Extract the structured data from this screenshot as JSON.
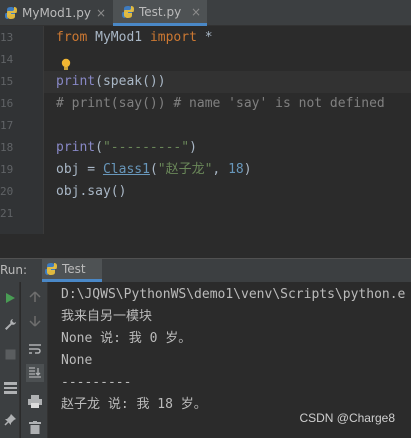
{
  "tabs": [
    {
      "label": "MyMod1.py",
      "close": "×"
    },
    {
      "label": "Test.py",
      "close": "×"
    }
  ],
  "editor": {
    "line_numbers": [
      "13",
      "14",
      "15",
      "16",
      "17",
      "18",
      "19",
      "20",
      "21"
    ],
    "lines": [
      [
        {
          "t": "from",
          "c": "kw"
        },
        {
          "t": " MyMod1 ",
          "c": "plain"
        },
        {
          "t": "import",
          "c": "kw"
        },
        {
          "t": " *",
          "c": "plain"
        }
      ],
      [],
      [
        {
          "t": "print",
          "c": "fn"
        },
        {
          "t": "(speak())",
          "c": "plain"
        }
      ],
      [
        {
          "t": "# print(say()) # name 'say' is not defined",
          "c": "cmt"
        }
      ],
      [],
      [
        {
          "t": "print",
          "c": "fn"
        },
        {
          "t": "(",
          "c": "plain"
        },
        {
          "t": "\"---------\"",
          "c": "str"
        },
        {
          "t": ")",
          "c": "plain"
        }
      ],
      [
        {
          "t": "obj = ",
          "c": "plain"
        },
        {
          "t": "Class1",
          "c": "cls"
        },
        {
          "t": "(",
          "c": "plain"
        },
        {
          "t": "\"赵子龙\"",
          "c": "str"
        },
        {
          "t": ", ",
          "c": "plain"
        },
        {
          "t": "18",
          "c": "num"
        },
        {
          "t": ")",
          "c": "plain"
        }
      ],
      [
        {
          "t": "obj.say()",
          "c": "plain"
        }
      ],
      []
    ]
  },
  "run": {
    "label": "Run:",
    "tab_label": "Test"
  },
  "console": {
    "lines": [
      "D:\\JQWS\\PythonWS\\demo1\\venv\\Scripts\\python.e",
      "我来自另一模块",
      "None 说: 我 0 岁。",
      "None",
      "---------",
      "赵子龙 说: 我 18 岁。"
    ]
  },
  "watermark": "CSDN @Charge8",
  "colors": {
    "keyword": "#cc7832",
    "builtin": "#8888c6",
    "comment": "#808080",
    "string": "#6a8759",
    "number": "#6897bb",
    "accent": "#4a88c7",
    "run_green": "#499c54"
  }
}
